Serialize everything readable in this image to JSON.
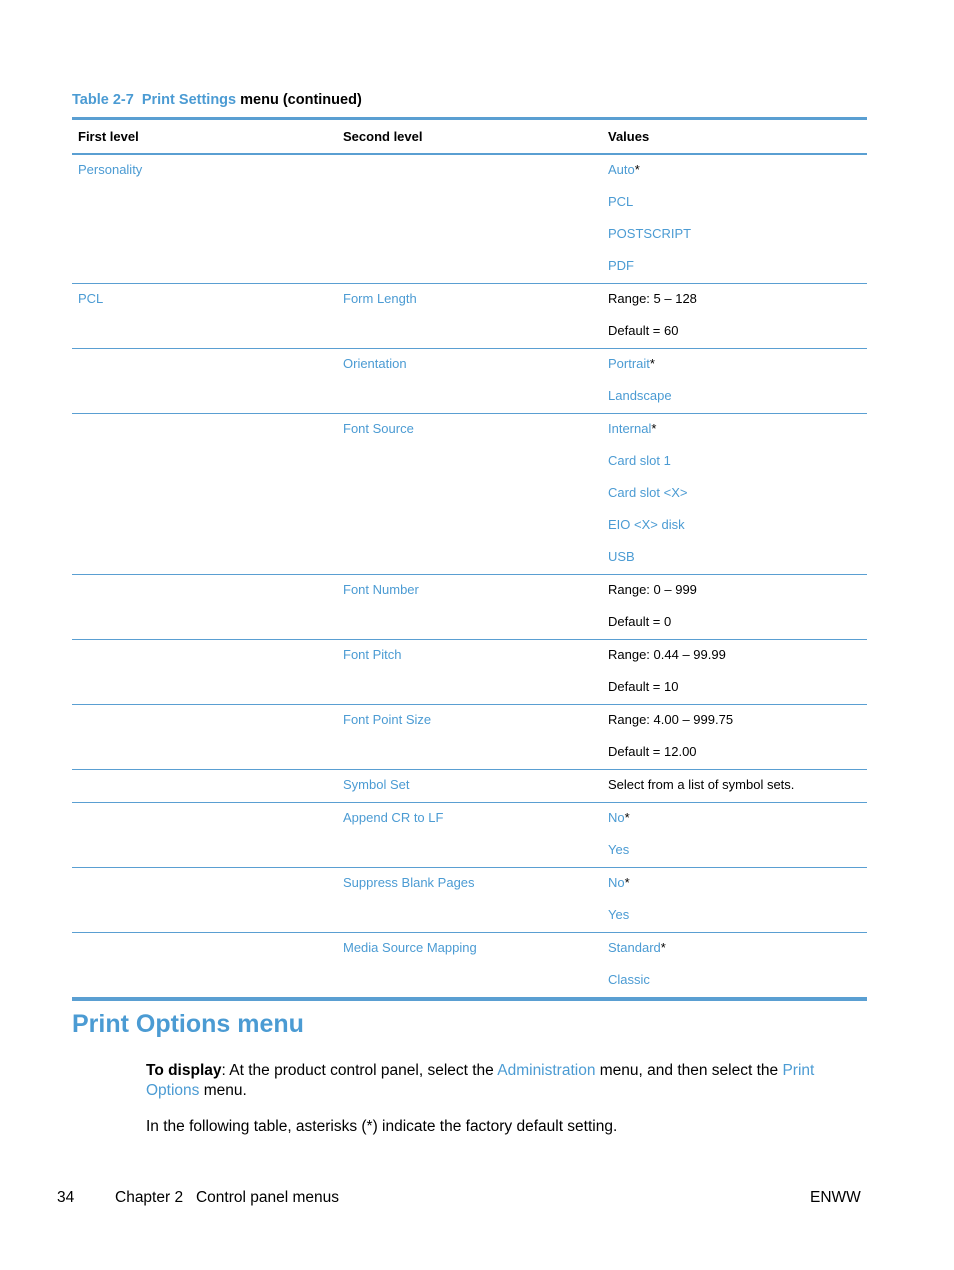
{
  "caption": {
    "table_id": "Table 2-7",
    "menu_name": "Print Settings",
    "suffix": "menu (continued)"
  },
  "table": {
    "headers": [
      "First level",
      "Second level",
      "Values"
    ],
    "groups": [
      {
        "first": "Personality",
        "second": "",
        "values": [
          {
            "text": "Auto",
            "link": true,
            "default": true
          },
          {
            "text": "PCL",
            "link": true,
            "default": false
          },
          {
            "text": "POSTSCRIPT",
            "link": true,
            "default": false
          },
          {
            "text": "PDF",
            "link": true,
            "default": false
          }
        ]
      },
      {
        "first": "PCL",
        "second": "Form Length",
        "values": [
          {
            "text": "Range: 5 – 128",
            "link": false,
            "default": false
          },
          {
            "text": "Default = 60",
            "link": false,
            "default": false
          }
        ]
      },
      {
        "first": "",
        "second": "Orientation",
        "values": [
          {
            "text": "Portrait",
            "link": true,
            "default": true
          },
          {
            "text": "Landscape",
            "link": true,
            "default": false
          }
        ]
      },
      {
        "first": "",
        "second": "Font Source",
        "values": [
          {
            "text": "Internal",
            "link": true,
            "default": true
          },
          {
            "text": "Card slot 1",
            "link": true,
            "default": false
          },
          {
            "text": "Card slot <X>",
            "link": true,
            "default": false
          },
          {
            "text": "EIO <X> disk",
            "link": true,
            "default": false
          },
          {
            "text": "USB",
            "link": true,
            "default": false
          }
        ]
      },
      {
        "first": "",
        "second": "Font Number",
        "values": [
          {
            "text": "Range: 0 – 999",
            "link": false,
            "default": false
          },
          {
            "text": "Default = 0",
            "link": false,
            "default": false
          }
        ]
      },
      {
        "first": "",
        "second": "Font Pitch",
        "values": [
          {
            "text": "Range: 0.44 – 99.99",
            "link": false,
            "default": false
          },
          {
            "text": "Default = 10",
            "link": false,
            "default": false
          }
        ]
      },
      {
        "first": "",
        "second": "Font Point Size",
        "values": [
          {
            "text": "Range: 4.00 – 999.75",
            "link": false,
            "default": false
          },
          {
            "text": "Default = 12.00",
            "link": false,
            "default": false
          }
        ]
      },
      {
        "first": "",
        "second": "Symbol Set",
        "values": [
          {
            "text": "Select from a list of symbol sets.",
            "link": false,
            "default": false
          }
        ]
      },
      {
        "first": "",
        "second": "Append CR to LF",
        "values": [
          {
            "text": "No",
            "link": true,
            "default": true
          },
          {
            "text": "Yes",
            "link": true,
            "default": false
          }
        ]
      },
      {
        "first": "",
        "second": "Suppress Blank Pages",
        "values": [
          {
            "text": "No",
            "link": true,
            "default": true
          },
          {
            "text": "Yes",
            "link": true,
            "default": false
          }
        ]
      },
      {
        "first": "",
        "second": "Media Source Mapping",
        "values": [
          {
            "text": "Standard",
            "link": true,
            "default": true
          },
          {
            "text": "Classic",
            "link": true,
            "default": false
          }
        ]
      }
    ],
    "default_marker": "*"
  },
  "section": {
    "title": "Print Options menu",
    "p1": {
      "lead": "To display",
      "t1": ": At the product control panel, select the ",
      "link1": "Administration",
      "t2": " menu, and then select the ",
      "link2": "Print Options",
      "t3": " menu."
    },
    "p2": "In the following table, asterisks (*) indicate the factory default setting."
  },
  "footer": {
    "page_number": "34",
    "chapter": "Chapter 2   Control panel menus",
    "locale": "ENWW"
  },
  "colors": {
    "accent": "#4b9bd3",
    "rule": "#5a9fd2"
  }
}
